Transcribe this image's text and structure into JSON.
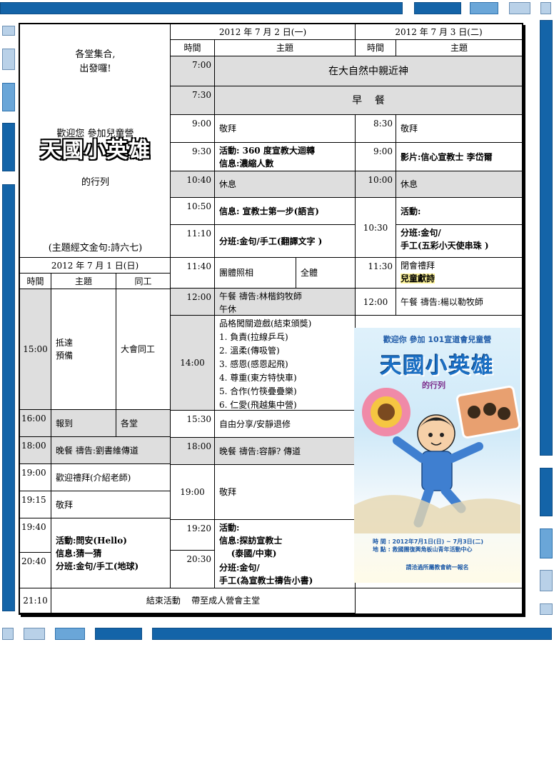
{
  "left_panel": {
    "line1": "各堂集合,",
    "line2": "出發囉!",
    "welcome": "歡迎您 參加兒童營",
    "logo_title": "天國小英雄",
    "subtitle": "的行列",
    "verse": "(主題經文金句:詩六七)"
  },
  "day1": {
    "date": "2012 年 7 月 1 日(日)",
    "headers": [
      "時間",
      "主題",
      "同工"
    ],
    "rows": [
      {
        "time": "15:00",
        "topic": "抵達\n預備",
        "staff": "大會同工"
      },
      {
        "time": "16:00",
        "topic": "報到",
        "staff": "各堂"
      },
      {
        "time": "18:00",
        "topic": "晚餐  禱告:劉書維傳道",
        "staff": ""
      },
      {
        "time": "19:00",
        "topic": "歡迎禮拜(介紹老師)",
        "staff": ""
      },
      {
        "time": "19:15",
        "topic": "敬拜",
        "staff": ""
      },
      {
        "time": "19:40",
        "topic": "活動:問安(Hello)\n信息:猜一猜\n分班:金句/手工(地球)",
        "staff": ""
      },
      {
        "time": "20:40",
        "topic": "",
        "staff": ""
      },
      {
        "time": "21:10",
        "topic": "結束活動    帶至成人營會主堂",
        "staff": ""
      }
    ]
  },
  "day2": {
    "date": "2012 年 7 月 2 日(一)",
    "headers": [
      "時間",
      "主題"
    ],
    "rows": [
      {
        "time": "7:00",
        "topic": "在大自然中親近神"
      },
      {
        "time": "7:30",
        "topic": "早    餐"
      },
      {
        "time": "9:00",
        "topic": "敬拜"
      },
      {
        "time": "9:30",
        "topic": "活動: 360 度宣教大迴轉\n信息:濃縮人數"
      },
      {
        "time": "10:40",
        "topic": "休息"
      },
      {
        "time": "10:50",
        "topic": "信息: 宣教士第一步(語言)"
      },
      {
        "time": "11:10",
        "topic": "分班:金句/手工(翻譯文字 )"
      },
      {
        "time": "11:40",
        "topic": "團體照相",
        "note": "全體"
      },
      {
        "time": "12:00",
        "topic": "午餐  禱告:林楷鈞牧師\n午休"
      },
      {
        "time": "14:00",
        "topic": "品格闖關遊戲(結束頒獎)\n1.  負責(拉線乒乓)\n2.  溫柔(傳吸管)\n3.  感恩(感恩起飛)\n4.  尊重(東方特快車)\n5.  合作(竹筷疊疊樂)\n6.  仁愛(飛越集中營)"
      },
      {
        "time": "15:30",
        "topic": "自由分享/安靜退修"
      },
      {
        "time": "18:00",
        "topic": "晚餐  禱告:容靜? 傳道"
      },
      {
        "time": "19:00",
        "topic": "敬拜"
      },
      {
        "time": "19:20",
        "topic": "活動:\n信息:探訪宣教士\n    (泰國/中東)"
      },
      {
        "time": "20:30",
        "topic": "分班:金句/\n手工(為宣教士禱告小書)"
      }
    ]
  },
  "day3": {
    "date": "2012 年 7 月 3 日(二)",
    "headers": [
      "時間",
      "主題"
    ],
    "rows": [
      {
        "time": "8:30",
        "topic": "敬拜"
      },
      {
        "time": "9:00",
        "topic": "影片:信心宣教士 李岱爾"
      },
      {
        "time": "10:00",
        "topic": "休息"
      },
      {
        "time": "10:30",
        "topic": "活動:"
      },
      {
        "time": "",
        "topic": "分班:金句/\n手工(五彩小天使串珠 )"
      },
      {
        "time": "11:30",
        "topic": "閉會禮拜",
        "highlight": "兒童獻詩"
      },
      {
        "time": "12:00",
        "topic": "午餐  禱告:楊以勒牧師"
      }
    ]
  },
  "poster": {
    "header": "歡迎你 參加 101宣道會兒童營",
    "title": "天國小英雄",
    "subtitle": "的行列",
    "time_line": "時 間 : 2012年7月1日(日) ~ 7月3日(二)",
    "place_line": "地 點 : 救國團復興角板山青年活動中心",
    "footer": "請洽過所屬教會統一報名",
    "colors": {
      "title": "#1a6fc4",
      "robe": "#3f7fd0",
      "background": "#dff1fb"
    }
  },
  "colors": {
    "dark_blue": "#1464a8",
    "mid_blue": "#6aa6d8",
    "light_blue": "#b9d1e8",
    "gray_cell": "#dedede"
  }
}
